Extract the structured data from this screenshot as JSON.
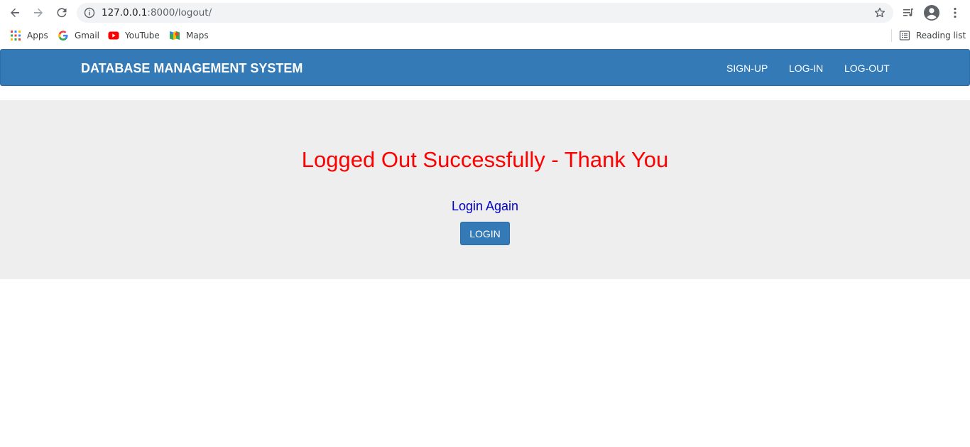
{
  "browser": {
    "url_host": "127.0.0.1",
    "url_rest": ":8000/logout/",
    "bookmarks": [
      {
        "label": "Apps",
        "icon": "apps-grid-icon"
      },
      {
        "label": "Gmail",
        "icon": "google-icon"
      },
      {
        "label": "YouTube",
        "icon": "youtube-icon"
      },
      {
        "label": "Maps",
        "icon": "maps-icon"
      }
    ],
    "reading_list_label": "Reading list"
  },
  "navbar": {
    "brand": "DATABASE MANAGEMENT SYSTEM",
    "links": [
      {
        "label": "SIGN-UP"
      },
      {
        "label": "LOG-IN"
      },
      {
        "label": "LOG-OUT"
      }
    ],
    "color": "#337ab7"
  },
  "main": {
    "message": "Logged Out Successfully - Thank You",
    "message_color": "#ff0000",
    "login_again": "Login Again",
    "login_again_color": "#0000cc",
    "login_button": "LOGIN"
  }
}
